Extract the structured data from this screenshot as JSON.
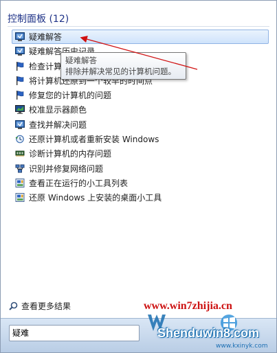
{
  "section": {
    "title": "控制面板 (12)"
  },
  "results": [
    {
      "label": "疑难解答",
      "icon": "troubleshoot-icon",
      "selected": true
    },
    {
      "label": "疑难解答历史记录",
      "icon": "troubleshoot-icon"
    },
    {
      "label": "检查计算机的状态并解决问题",
      "icon": "action-center-flag-icon"
    },
    {
      "label": "将计算机还原到一个较早的时间点",
      "icon": "action-center-flag-icon"
    },
    {
      "label": "修复您的计算机的问题",
      "icon": "action-center-flag-icon"
    },
    {
      "label": "校准显示器颜色",
      "icon": "monitor-icon"
    },
    {
      "label": "查找并解决问题",
      "icon": "troubleshoot-icon"
    },
    {
      "label": "还原计算机或者重新安装 Windows",
      "icon": "restore-icon"
    },
    {
      "label": "诊断计算机的内存问题",
      "icon": "memory-diagnostic-icon"
    },
    {
      "label": "识别并修复网络问题",
      "icon": "network-icon"
    },
    {
      "label": "查看正在运行的小工具列表",
      "icon": "gadgets-icon"
    },
    {
      "label": "还原 Windows 上安装的桌面小工具",
      "icon": "gadgets-icon"
    }
  ],
  "tooltip": {
    "title": "疑难解答",
    "description": "排除并解决常见的计算机问题。"
  },
  "see_more": {
    "label": "查看更多结果"
  },
  "search": {
    "value": "疑难"
  },
  "watermark": {
    "url": "www.win7zhijia.cn",
    "site": "Shenduwin8.com",
    "domain": "www.kxinyk.com"
  },
  "colors": {
    "header": "#1e3287",
    "arrow": "#d01010",
    "selection": "#cfe3fb"
  }
}
